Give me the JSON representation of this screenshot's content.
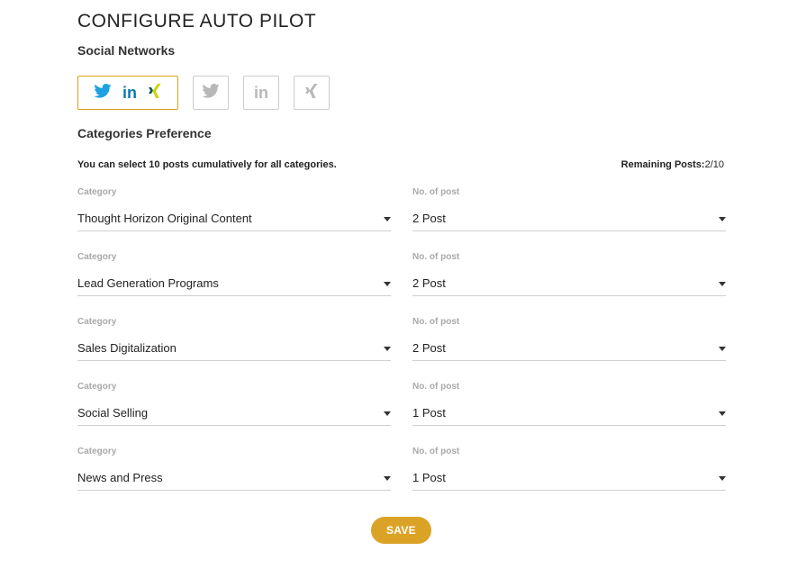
{
  "header": {
    "title": "CONFIGURE AUTO PILOT"
  },
  "social_networks": {
    "title": "Social Networks",
    "buttons": [
      {
        "id": "all",
        "icons": [
          "twitter-icon",
          "linkedin-icon",
          "xing-icon"
        ],
        "selected": true
      },
      {
        "id": "twitter",
        "icons": [
          "twitter-icon"
        ],
        "selected": false
      },
      {
        "id": "linkedin",
        "icons": [
          "linkedin-icon"
        ],
        "selected": false
      },
      {
        "id": "xing",
        "icons": [
          "xing-icon"
        ],
        "selected": false
      }
    ],
    "linkedin_glyph": "in"
  },
  "categories": {
    "title": "Categories Preference",
    "info_text": "You can select 10 posts cumulatively for all categories.",
    "remaining_label": "Remaining Posts:",
    "remaining_value": "2/10",
    "category_label": "Category",
    "posts_label": "No. of post",
    "rows": [
      {
        "category": "Thought Horizon Original Content",
        "posts": "2 Post"
      },
      {
        "category": "Lead Generation Programs",
        "posts": "2 Post"
      },
      {
        "category": "Sales Digitalization",
        "posts": "2 Post"
      },
      {
        "category": "Social Selling",
        "posts": "1 Post"
      },
      {
        "category": "News and Press",
        "posts": "1 Post"
      }
    ]
  },
  "actions": {
    "save_label": "SAVE"
  },
  "colors": {
    "accent": "#dba326",
    "twitter": "#1da1e2",
    "linkedin": "#0a7ab7",
    "xing_dark": "#0b5b57",
    "xing_light": "#c8d400",
    "inactive_icon": "#b8b8b8"
  }
}
